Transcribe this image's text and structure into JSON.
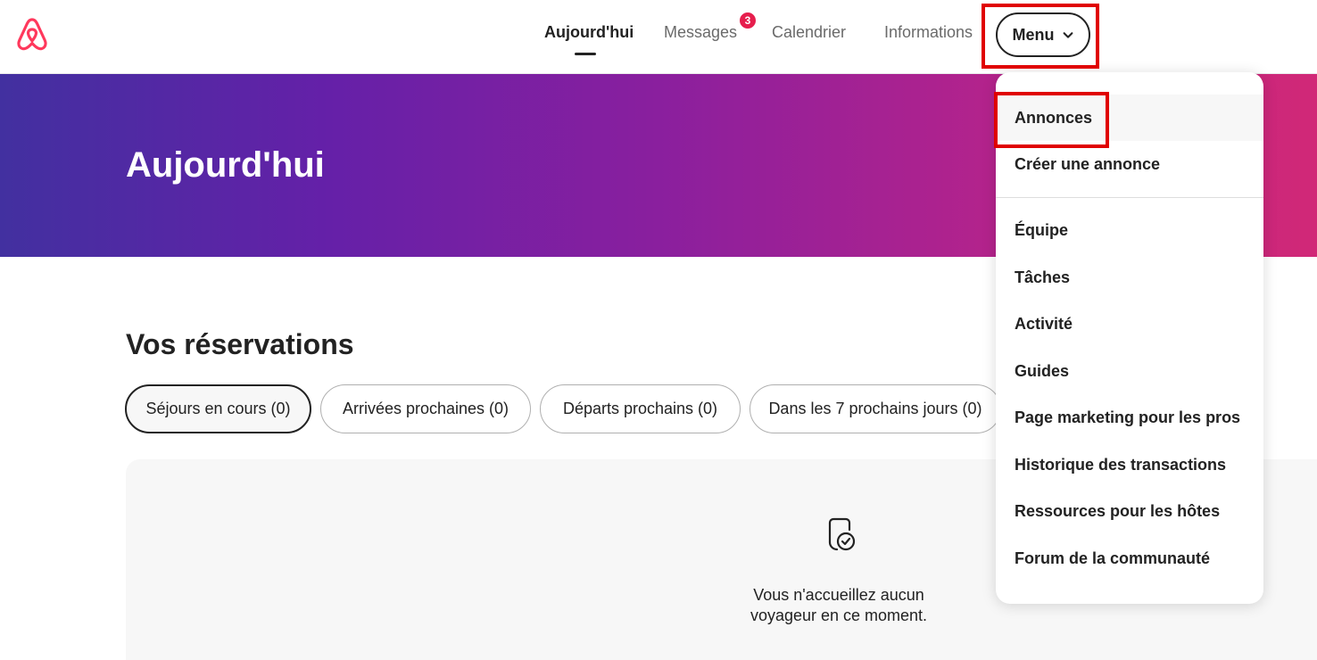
{
  "header": {
    "nav": {
      "today": "Aujourd'hui",
      "messages": "Messages",
      "messages_badge": "3",
      "calendar": "Calendrier",
      "info": "Informations"
    },
    "menu_label": "Menu",
    "brand_color": "#FF385C",
    "badge_color": "#E61E4D"
  },
  "banner": {
    "title": "Aujourd'hui"
  },
  "reservations": {
    "title": "Vos réservations",
    "filters": [
      {
        "label": "Séjours en cours (0)",
        "selected": true
      },
      {
        "label": "Arrivées prochaines (0)",
        "selected": false
      },
      {
        "label": "Départs prochains (0)",
        "selected": false
      },
      {
        "label": "Dans les 7 prochains jours (0)",
        "selected": false
      }
    ],
    "empty_icon": "checked-document-icon",
    "empty_line1": "Vous n'accueillez aucun",
    "empty_line2": "voyageur en ce moment."
  },
  "dropdown": {
    "items": [
      "Annonces",
      "Créer une annonce",
      "Équipe",
      "Tâches",
      "Activité",
      "Guides",
      "Page marketing pour les pros",
      "Historique des transactions",
      "Ressources pour les hôtes",
      "Forum de la communauté"
    ]
  },
  "highlight_color": "#E00000"
}
